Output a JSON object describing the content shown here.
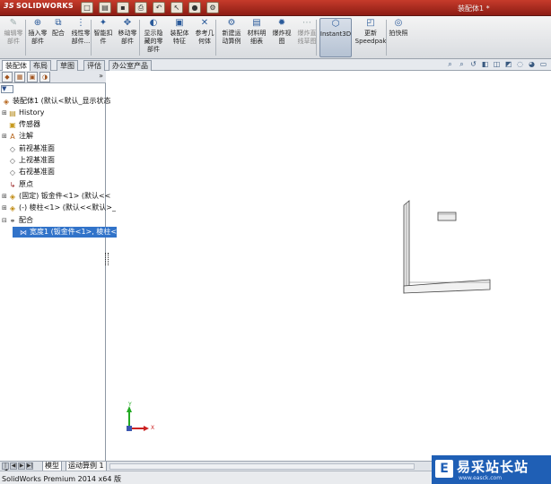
{
  "window": {
    "app_logo": "SOLIDWORKS",
    "doc_title": "装配体1 *"
  },
  "commands": [
    {
      "label": "编辑零\n部件",
      "icon": "edit-component-icon",
      "enabled": false
    },
    {
      "label": "插入零\n部件",
      "icon": "insert-component-icon",
      "enabled": true
    },
    {
      "label": "配合",
      "icon": "mate-icon",
      "enabled": true
    },
    {
      "label": "线性零\n部件...",
      "icon": "linear-pattern-icon",
      "enabled": true
    },
    {
      "label": "智能扣\n件",
      "icon": "smart-fastener-icon",
      "enabled": true
    },
    {
      "label": "移动零\n部件",
      "icon": "move-component-icon",
      "enabled": true
    },
    {
      "label": "显示隐\n藏的零\n部件",
      "icon": "show-hidden-icon",
      "enabled": true
    },
    {
      "label": "装配体\n特征",
      "icon": "assembly-feature-icon",
      "enabled": true
    },
    {
      "label": "参考几\n何体",
      "icon": "reference-geometry-icon",
      "enabled": true
    },
    {
      "label": "新建运\n动算例",
      "icon": "motion-study-icon",
      "enabled": true
    },
    {
      "label": "材料明\n细表",
      "icon": "bom-icon",
      "enabled": true
    },
    {
      "label": "爆炸视\n图",
      "icon": "exploded-view-icon",
      "enabled": true
    },
    {
      "label": "爆炸直\n线草图",
      "icon": "explode-line-icon",
      "enabled": false
    },
    {
      "label": "Instant3D",
      "icon": "instant3d-icon",
      "enabled": true,
      "selected": true
    },
    {
      "label": "更新\nSpeedpak",
      "icon": "speedpak-icon",
      "enabled": true
    },
    {
      "label": "拍快照",
      "icon": "snapshot-icon",
      "enabled": true
    }
  ],
  "tabs": [
    "装配体",
    "布局",
    "草图",
    "评估",
    "办公室产品"
  ],
  "tree": {
    "root": "装配体1 (默认<默认_显示状态",
    "items": [
      {
        "label": "History",
        "icon": "history-icon",
        "expandable": true
      },
      {
        "label": "传感器",
        "icon": "sensor-icon",
        "expandable": false
      },
      {
        "label": "注解",
        "icon": "annotation-icon",
        "expandable": true
      },
      {
        "label": "前视基准面",
        "icon": "plane-icon",
        "expandable": false
      },
      {
        "label": "上视基准面",
        "icon": "plane-icon",
        "expandable": false
      },
      {
        "label": "右视基准面",
        "icon": "plane-icon",
        "expandable": false
      },
      {
        "label": "原点",
        "icon": "origin-icon",
        "expandable": false
      },
      {
        "label": "(固定) 钣金件<1> (默认<<",
        "icon": "part-icon",
        "expandable": true
      },
      {
        "label": "(-) 棱柱<1> (默认<<默认>_",
        "icon": "part-icon",
        "expandable": true
      },
      {
        "label": "配合",
        "icon": "mates-folder-icon",
        "expandable": true
      },
      {
        "label": "宽度1 (钣金件<1>, 棱柱<",
        "icon": "width-mate-icon",
        "expandable": false,
        "selected": true
      }
    ]
  },
  "bottom_tabs": [
    "模型",
    "运动算例 1"
  ],
  "status": "SolidWorks Premium 2014 x64 版",
  "watermark": {
    "text": "易采站长站",
    "url": "www.easck.com"
  },
  "triad": {
    "x": "X",
    "y": "Y"
  },
  "colors": {
    "titlebar": "#c63b2b",
    "selection": "#3173c9",
    "triad_x": "#cc2222",
    "triad_y": "#22aa22"
  }
}
